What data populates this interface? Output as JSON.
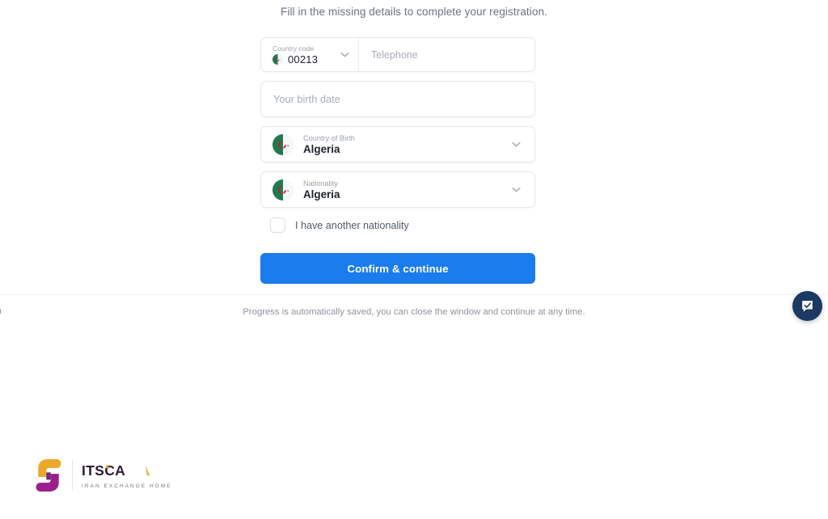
{
  "page": {
    "headline": "Fill in the missing details to complete your registration."
  },
  "form": {
    "country_code": {
      "label": "Country code",
      "value": "00213",
      "flag_icon": "algeria-flag-icon",
      "chevron_icon": "chevron-down-icon"
    },
    "telephone": {
      "placeholder": "Telephone",
      "value": ""
    },
    "birth_date": {
      "placeholder": "Your birth date",
      "value": ""
    },
    "country_of_birth": {
      "label": "Country of Birth",
      "value": "Algeria",
      "flag_icon": "algeria-flag-icon",
      "chevron_icon": "chevron-down-icon"
    },
    "nationality": {
      "label": "Nationality",
      "value": "Algeria",
      "flag_icon": "algeria-flag-icon",
      "chevron_icon": "chevron-down-icon"
    },
    "another_nationality": {
      "label": "I have another nationality",
      "checked": false
    },
    "submit_label": "Confirm & continue"
  },
  "footer": {
    "language_link": "glish",
    "note": "Progress is automatically saved, you can close the window and continue at any time.",
    "badge_icon": "verified-chat-check-icon"
  },
  "brand": {
    "name": "ITSCA",
    "tagline": "IRAN EXCHANGE HOME",
    "mark_icon": "itsca-logo-icon"
  },
  "colors": {
    "primary_button": "#1b7ced",
    "badge": "#1b3a63",
    "flag_green": "#1f7a4d",
    "flag_red": "#d21034",
    "brand_yellow": "#e9a92b",
    "brand_purple": "#9b1f8c",
    "brand_dark": "#2b1b33"
  }
}
